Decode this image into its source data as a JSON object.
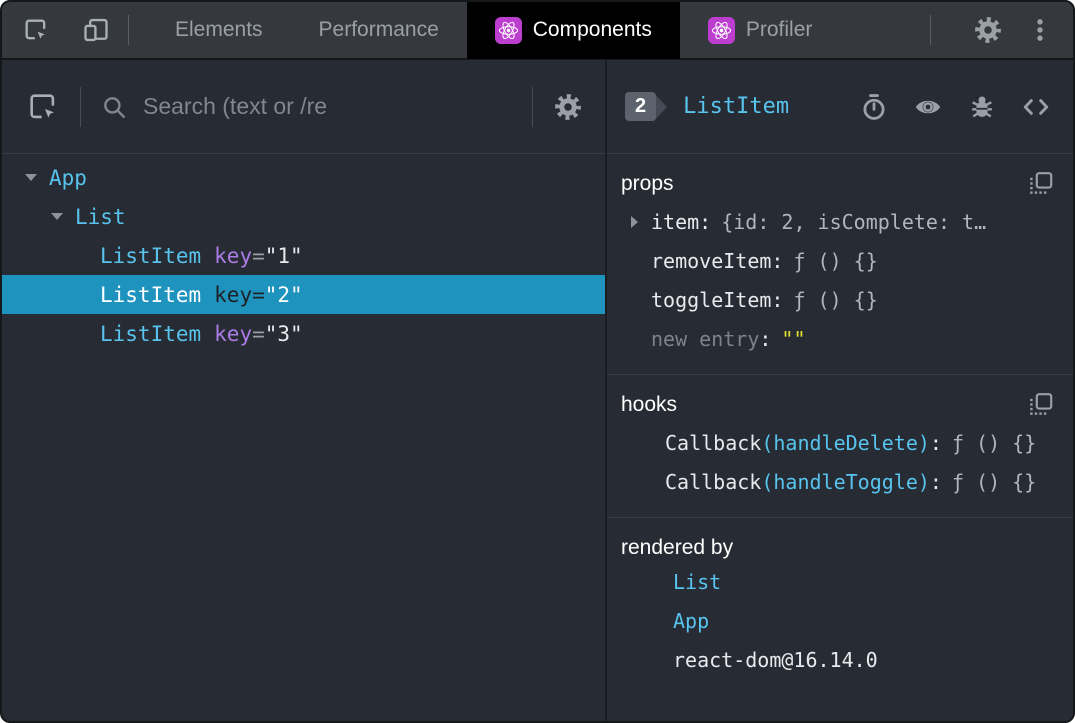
{
  "colors": {
    "selected_row_blue": "#1e93bd",
    "component_cyan": "#58c4ee",
    "attribute_purple": "#ab7ce5",
    "string_yellow": "#e5e332",
    "react_icon_purple": "#bb3ecf",
    "active_tab_bg": "#000000",
    "panel_bg": "#272b33",
    "topbar_bg": "#35383d"
  },
  "topbar": {
    "tabs": [
      {
        "label": "Elements"
      },
      {
        "label": "Performance"
      },
      {
        "label": "Components"
      },
      {
        "label": "Profiler"
      }
    ]
  },
  "left": {
    "search_placeholder": "Search (text or /re",
    "tree": [
      {
        "name": "App"
      },
      {
        "name": "List"
      },
      {
        "name": "ListItem",
        "attr": "key",
        "eq": "=",
        "value": "\"1\""
      },
      {
        "name": "ListItem",
        "attr": "key",
        "eq": "=",
        "value": "\"2\""
      },
      {
        "name": "ListItem",
        "attr": "key",
        "eq": "=",
        "value": "\"3\""
      }
    ]
  },
  "right": {
    "badge": "2",
    "component": "ListItem",
    "props": {
      "title": "props",
      "rows": [
        {
          "name": "item",
          "colon": ":",
          "value": "{id: 2, isComplete: t…"
        },
        {
          "name": "removeItem",
          "colon": ":",
          "value": "ƒ () {}"
        },
        {
          "name": "toggleItem",
          "colon": ":",
          "value": "ƒ () {}"
        },
        {
          "name": "new entry",
          "colon": ":",
          "value": "\"\""
        }
      ]
    },
    "hooks": {
      "title": "hooks",
      "rows": [
        {
          "fn": "Callback",
          "arg": "(handleDelete)",
          "colon": ":",
          "value": "ƒ () {}"
        },
        {
          "fn": "Callback",
          "arg": "(handleToggle)",
          "colon": ":",
          "value": "ƒ () {}"
        }
      ]
    },
    "rendered_by": {
      "title": "rendered by",
      "links": [
        "List",
        "App"
      ],
      "version": "react-dom@16.14.0"
    }
  }
}
